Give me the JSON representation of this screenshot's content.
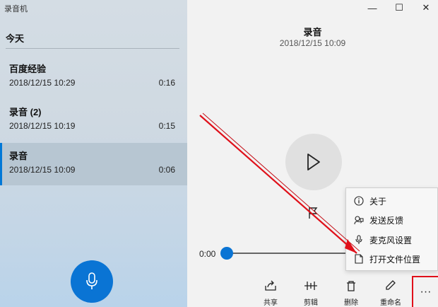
{
  "app": {
    "title": "录音机"
  },
  "list": {
    "section": "今天",
    "items": [
      {
        "name": "百度经验",
        "date": "2018/12/15 10:29",
        "duration": "0:16"
      },
      {
        "name": "录音 (2)",
        "date": "2018/12/15 10:19",
        "duration": "0:15"
      },
      {
        "name": "录音",
        "date": "2018/12/15 10:09",
        "duration": "0:06"
      }
    ],
    "selected_index": 2
  },
  "player": {
    "title": "录音",
    "date": "2018/12/15 10:09",
    "time_start": "0:00",
    "progress": 0.0
  },
  "toolbar": {
    "share": "共享",
    "trim": "剪辑",
    "delete": "删除",
    "rename": "重命名",
    "more": "···"
  },
  "menu": {
    "items": [
      {
        "label": "关于",
        "icon": "info-icon"
      },
      {
        "label": "发送反馈",
        "icon": "feedback-icon"
      },
      {
        "label": "麦克风设置",
        "icon": "microphone-icon"
      },
      {
        "label": "打开文件位置",
        "icon": "file-icon"
      }
    ]
  },
  "window": {
    "minimize": "—",
    "maximize": "☐",
    "close": "✕"
  },
  "colors": {
    "accent": "#0a74d4",
    "annotation": "#e0101a"
  }
}
